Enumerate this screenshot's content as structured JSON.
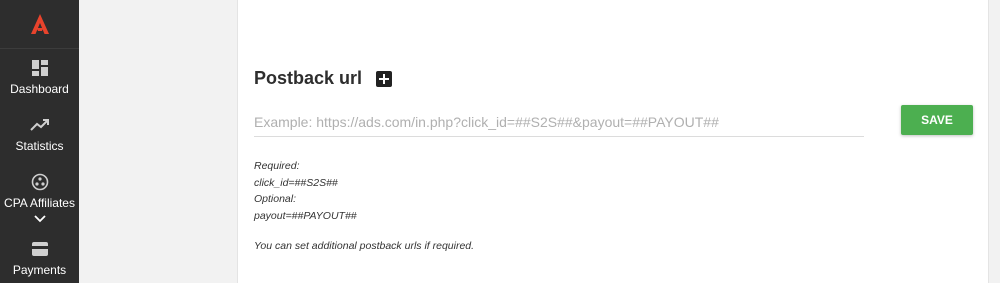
{
  "sidebar": {
    "logo_icon": "brand-a-logo",
    "brand_color": "#e8432c",
    "items": [
      {
        "label": "Dashboard",
        "icon": "dashboard-icon"
      },
      {
        "label": "Statistics",
        "icon": "trending-up-icon"
      },
      {
        "label": "CPA Affiliates",
        "icon": "affiliates-icon",
        "expandable": true
      },
      {
        "label": "Payments",
        "icon": "credit-card-icon"
      }
    ]
  },
  "main": {
    "title": "Postback url",
    "add_icon": "plus-box-icon",
    "input": {
      "value": "",
      "placeholder": "Example: https://ads.com/in.php?click_id=##S2S##&payout=##PAYOUT##"
    },
    "save_label": "SAVE",
    "save_color": "#4caf50",
    "help": {
      "required_label": "Required:",
      "required_value": "click_id=##S2S##",
      "optional_label": "Optional:",
      "optional_value": "payout=##PAYOUT##",
      "note": "You can set additional postback urls if required."
    }
  }
}
